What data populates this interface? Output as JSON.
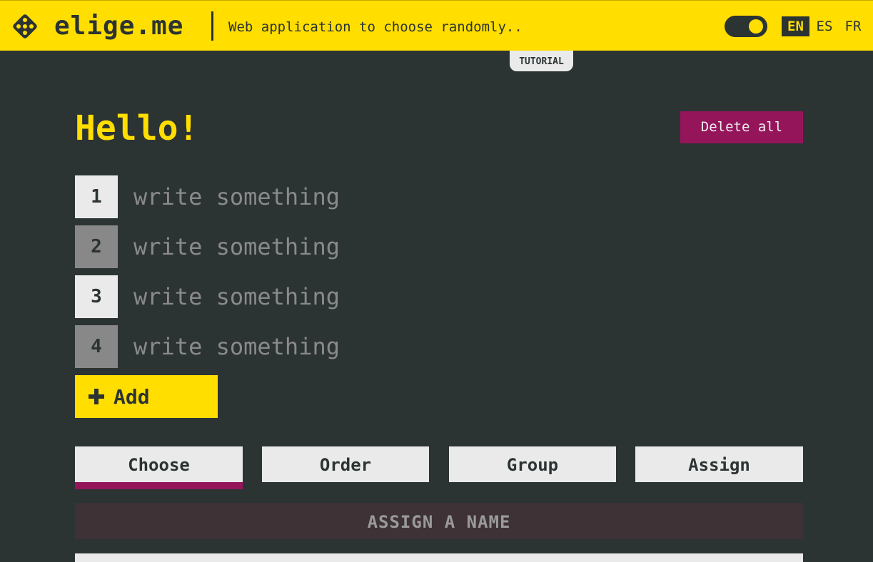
{
  "header": {
    "brand": "elige.me",
    "tagline": "Web application to choose randomly..",
    "languages": [
      "EN",
      "ES",
      "FR"
    ],
    "tutorial": "TUTORIAL",
    "accent_color": "#ffde00"
  },
  "main": {
    "title": "Hello!",
    "delete_all": "Delete all",
    "items": [
      {
        "number": "1",
        "placeholder": "write something"
      },
      {
        "number": "2",
        "placeholder": "write something"
      },
      {
        "number": "3",
        "placeholder": "write something"
      },
      {
        "number": "4",
        "placeholder": "write something"
      }
    ],
    "add_label": "Add",
    "tabs": [
      "Choose",
      "Order",
      "Group",
      "Assign"
    ],
    "active_tab": "Choose",
    "assign_label": "ASSIGN A NAME"
  },
  "colors": {
    "background": "#2c3333",
    "accent": "#ffde00",
    "magenta": "#95155b"
  }
}
